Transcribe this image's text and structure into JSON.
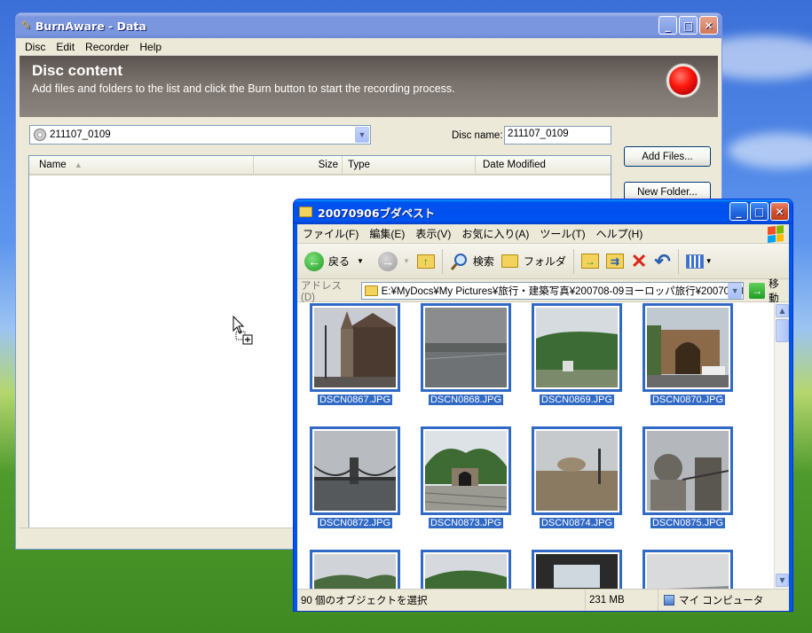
{
  "burnaware": {
    "title": "BurnAware - Data",
    "menu": [
      "Disc",
      "Edit",
      "Recorder",
      "Help"
    ],
    "header_title": "Disc content",
    "header_desc": "Add files and folders to the list and click the Burn button to start the recording process.",
    "path_value": "211107_0109",
    "disc_name_label": "Disc name:",
    "disc_name_value": "211107_0109",
    "columns": [
      "Name",
      "Size",
      "Type",
      "Date Modified"
    ],
    "add_files": "Add Files...",
    "new_folder": "New Folder..."
  },
  "explorer": {
    "title": "20070906ブダペスト",
    "menu": [
      "ファイル(F)",
      "編集(E)",
      "表示(V)",
      "お気に入り(A)",
      "ツール(T)",
      "ヘルプ(H)"
    ],
    "toolbar": {
      "back": "戻る",
      "search": "検索",
      "folders": "フォルダ"
    },
    "address_label": "アドレス(D)",
    "address_value": "E:¥MyDocs¥My Pictures¥旅行・建築写真¥200708-09ヨーロッパ旅行¥20070906ブ",
    "go": "移動",
    "files": [
      "DSCN0867.JPG",
      "DSCN0868.JPG",
      "DSCN0869.JPG",
      "DSCN0870.JPG",
      "DSCN0872.JPG",
      "DSCN0873.JPG",
      "DSCN0874.JPG",
      "DSCN0875.JPG"
    ],
    "status_selected": "90 個のオブジェクトを選択",
    "status_size": "231 MB",
    "status_location": "マイ コンピュータ"
  }
}
